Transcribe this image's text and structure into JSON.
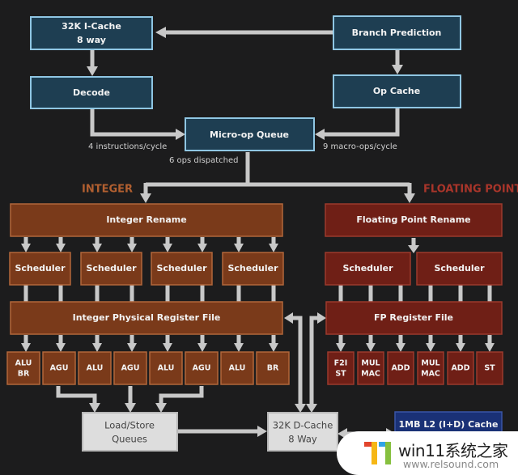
{
  "diagram": {
    "frontend": {
      "icache": {
        "line1": "32K I-Cache",
        "line2": "8 way"
      },
      "branch_prediction": "Branch Prediction",
      "decode": "Decode",
      "op_cache": "Op Cache",
      "micro_op_queue": "Micro-op Queue",
      "notes": {
        "decode_rate": "4 instructions/cycle",
        "op_cache_rate": "9 macro-ops/cycle",
        "dispatch": "6 ops dispatched"
      }
    },
    "integer": {
      "section_label": "INTEGER",
      "rename": "Integer Rename",
      "schedulers": [
        "Scheduler",
        "Scheduler",
        "Scheduler",
        "Scheduler"
      ],
      "register_file": "Integer Physical Register File",
      "units": [
        {
          "line1": "ALU",
          "line2": "BR"
        },
        {
          "line1": "AGU",
          "line2": ""
        },
        {
          "line1": "ALU",
          "line2": ""
        },
        {
          "line1": "AGU",
          "line2": ""
        },
        {
          "line1": "ALU",
          "line2": ""
        },
        {
          "line1": "AGU",
          "line2": ""
        },
        {
          "line1": "ALU",
          "line2": ""
        },
        {
          "line1": "BR",
          "line2": ""
        }
      ]
    },
    "floating_point": {
      "section_label": "FLOATING POINT",
      "rename": "Floating Point Rename",
      "schedulers": [
        "Scheduler",
        "Scheduler"
      ],
      "register_file": "FP Register File",
      "units": [
        {
          "line1": "F2I",
          "line2": "ST"
        },
        {
          "line1": "MUL",
          "line2": "MAC"
        },
        {
          "line1": "ADD",
          "line2": ""
        },
        {
          "line1": "MUL",
          "line2": "MAC"
        },
        {
          "line1": "ADD",
          "line2": ""
        },
        {
          "line1": "ST",
          "line2": ""
        }
      ]
    },
    "memory": {
      "load_store": {
        "line1": "Load/Store",
        "line2": "Queues"
      },
      "dcache": {
        "line1": "32K D-Cache",
        "line2": "8 Way"
      },
      "l2": "1MB L2 (I+D) Cache"
    },
    "colors": {
      "frontend_fill": "#1e3e52",
      "frontend_border": "#8fc6e3",
      "integer_fill": "#7a3a1a",
      "fp_fill": "#6f1f16",
      "memory_fill": "#dddddd",
      "l2_fill": "#1a3176",
      "wire": "#c8c8c8",
      "background": "#1c1c1d"
    }
  },
  "watermark": {
    "title": "win11系统之家",
    "url": "www.relsound.com"
  }
}
